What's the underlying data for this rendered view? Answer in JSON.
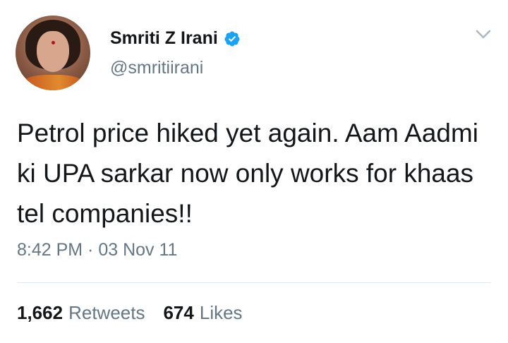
{
  "tweet": {
    "author": {
      "display_name": "Smriti Z Irani",
      "handle": "@smritiirani",
      "verified": true
    },
    "text": "Petrol price hiked yet again. Aam Aadmi ki UPA sarkar now only works for khaas tel companies!!",
    "timestamp": "8:42 PM · 03 Nov 11",
    "stats": {
      "retweets_count": "1,662",
      "retweets_label": "Retweets",
      "likes_count": "674",
      "likes_label": "Likes"
    }
  },
  "icons": {
    "verified": "verified-badge-icon",
    "menu": "chevron-down-icon"
  },
  "colors": {
    "primary_text": "#14171a",
    "secondary_text": "#657786",
    "verified_blue": "#1da1f2",
    "divider": "#e1e8ed"
  }
}
